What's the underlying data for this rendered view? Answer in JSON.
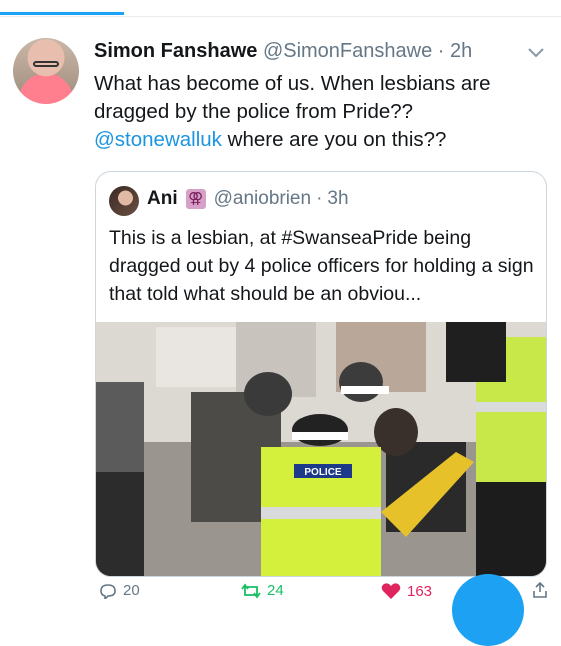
{
  "tweet": {
    "author_name": "Simon Fanshawe",
    "author_handle": "@SimonFanshawe",
    "separator": "·",
    "time": "2h",
    "text_part1": "What has become of us. When lesbians are dragged by the police from Pride??",
    "mention": "@stonewalluk",
    "text_part2": " where are you on this??"
  },
  "quote": {
    "author_name": "Ani",
    "emoji_symbol": "⚢",
    "author_handle": "@aniobrien",
    "separator": "·",
    "time": "3h",
    "text": "This is a lesbian, at #SwanseaPride being dragged out by 4 police officers for holding a sign that told what should be an obviou..."
  },
  "media": {
    "vest_text": "POLICE"
  },
  "actions": {
    "reply_count": "20",
    "retweet_count": "24",
    "like_count": "163"
  },
  "colors": {
    "accent": "#1da1f2",
    "mention": "#1b95e0",
    "retweet": "#17bf63",
    "like": "#e0245e",
    "secondary_text": "#657786"
  },
  "icons": [
    "chevron-down-icon",
    "reply-icon",
    "retweet-icon",
    "like-icon",
    "share-icon",
    "compose-icon"
  ]
}
